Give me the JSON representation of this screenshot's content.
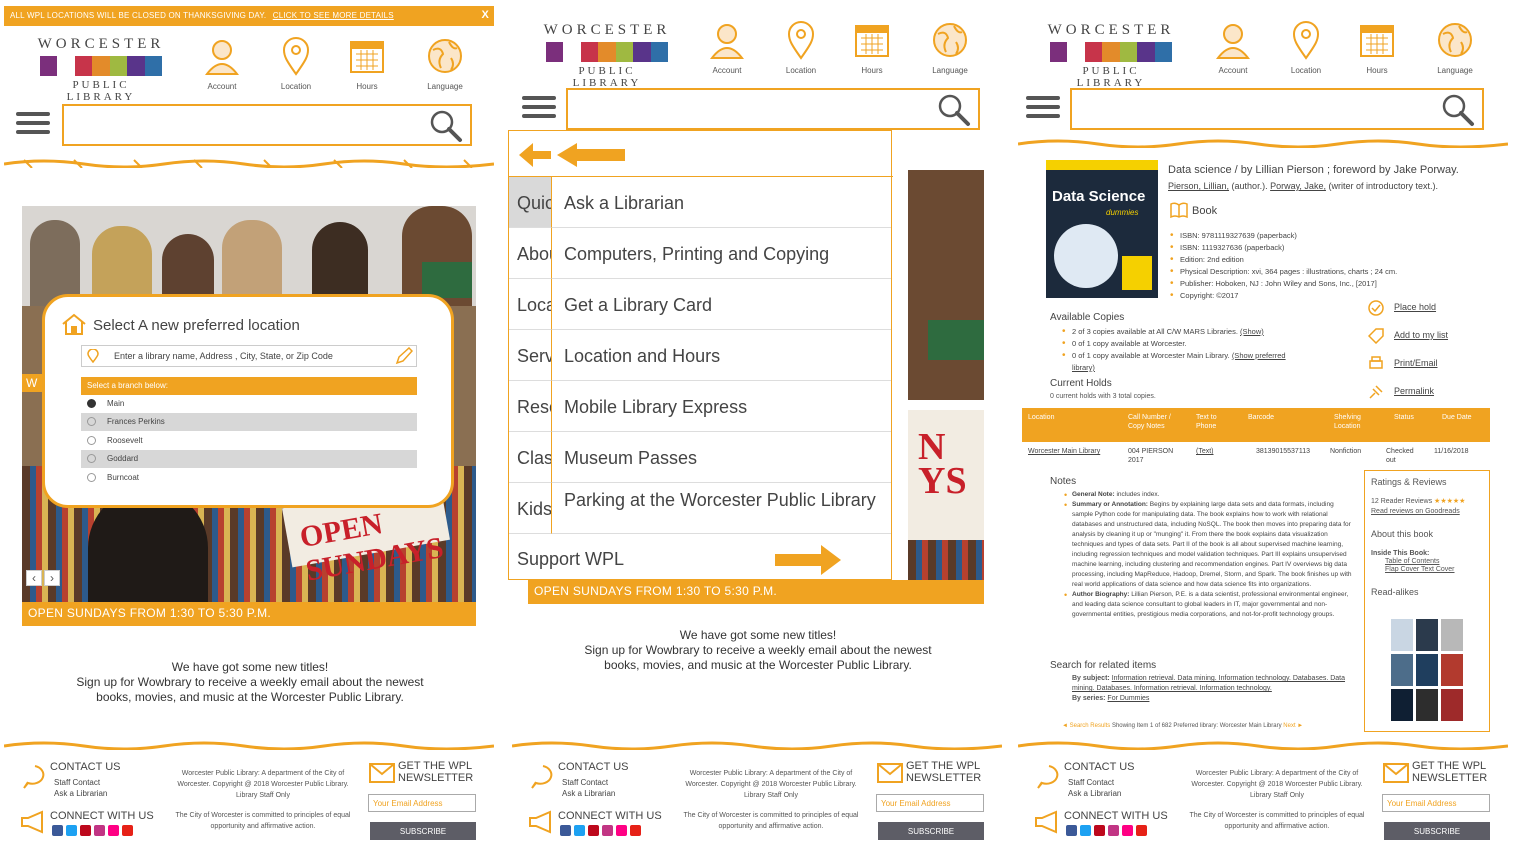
{
  "header": {
    "logo_top": "WORCESTER",
    "logo_bottom": "PUBLIC LIBRARY",
    "nav": [
      "Account",
      "Location",
      "Hours",
      "Language"
    ]
  },
  "alert": {
    "text": "ALL WPL LOCATIONS WILL BE CLOSED ON THANKSGIVING DAY.",
    "link": "CLICK TO SEE MORE DETAILS",
    "close": "X"
  },
  "hero": {
    "banner": "OPEN SUNDAYS FROM 1:30 TO 5:30 P.M.",
    "sign_text": "OPEN SUNDAYS",
    "w_letter": "W",
    "carousel_prev": "‹",
    "carousel_next": "›"
  },
  "promo": {
    "line1": "We have got some new titles!",
    "line2": "Sign up for Wowbrary to receive a weekly email about the newest",
    "line3": "books, movies, and music at the Worcester Public Library."
  },
  "location_modal": {
    "title": "Select A new preferred location",
    "placeholder": "Enter a library name, Address , City, State, or Zip Code",
    "select_header": "Select a branch below:",
    "options": [
      "Main",
      "Frances Perkins",
      "Roosevelt",
      "Goddard",
      "Burncoat"
    ],
    "selected": "Main"
  },
  "menu": {
    "left_tabs": [
      "Quick",
      "About",
      "Locations",
      "Services",
      "Resources",
      "Classes",
      "Kids"
    ],
    "items": [
      "Ask a Librarian",
      "Computers, Printing and Copying",
      "Get a Library Card",
      "Location and Hours",
      "Mobile Library Express",
      "Museum Passes",
      "Parking at the Worcester Public Library"
    ],
    "support": "Support WPL",
    "sign_text": "N\nYS"
  },
  "record": {
    "cover_title": "Data Science",
    "cover_sub": "dummies",
    "title": "Data science / by Lillian Pierson ; foreword by Jake Porway.",
    "author1": "Pierson, Lillian,",
    "author1_role": "(author.).",
    "author2": "Porway, Jake,",
    "author2_role": "(writer of introductory text.).",
    "type": "Book",
    "details": [
      "ISBN: 9781119327639 (paperback)",
      "ISBN: 1119327636 (paperback)",
      "Edition: 2nd edition",
      "Physical Description: xvi, 364 pages : illustrations, charts ; 24 cm.",
      "Publisher: Hoboken, NJ : John Wiley and Sons, Inc., [2017]",
      "Copyright: ©2017"
    ],
    "available_h": "Available Copies",
    "available": [
      "2 of 3 copies available at All C/W MARS Libraries.",
      "0 of 1 copy available at Worcester.",
      "0 of 1 copy available at Worcester Main Library."
    ],
    "show_link": "(Show)",
    "show_pref_link": "(Show preferred library)",
    "holds_h": "Current Holds",
    "holds": "0 current holds with 3 total copies.",
    "actions": [
      "Place hold",
      "Add to my list",
      "Print/Email",
      "Permalink"
    ],
    "table_headers": [
      "Location",
      "Call Number / Copy Notes",
      "Text to Phone",
      "Barcode",
      "Shelving Location",
      "Status",
      "Due Date"
    ],
    "table_row": [
      "Worcester Main Library",
      "004 PIERSON 2017",
      "(Text)",
      "38139015537113",
      "Nonfiction",
      "Checked out",
      "11/16/2018"
    ],
    "notes_h": "Notes",
    "notes": [
      {
        "label": "General Note:",
        "text": "includes index."
      },
      {
        "label": "Summary or Annotation:",
        "text": "Begins by explaining large data sets and data formats, including sample Python code for manipulating data. The book explains how to work with relational databases and unstructured data, including NoSQL. The book then moves into preparing data for analysis by cleaning it up or \"munging\" it. From there the book explains data visualization techniques and types of data sets. Part II of the book is all about supervised machine learning, including regression techniques and model validation techniques. Part III explains unsupervised machine learning, including clustering and recommendation engines. Part IV overviews big data processing, including MapReduce, Hadoop, Dremel, Storm, and Spark. The book finishes up with real world applications of data science and how data science fits into organizations."
      },
      {
        "label": "Author Biography:",
        "text": "Lillian Pierson, P.E. is a data scientist, professional environmental engineer, and leading data science consultant to global leaders in IT, major governmental and non-governmental entities, prestigious media corporations, and not-for-profit technology groups."
      }
    ],
    "related_h": "Search for related items",
    "by_subject": "By subject:",
    "subjects": "Information retrieval. Data mining. Information technology. Databases. Data mining. Databases. Information retrieval. Information technology.",
    "by_series": "By series:",
    "series": "For Dummies",
    "pager_prev": "◄ Search Results",
    "pager_text": "Showing Item 1 of 682 Preferred library: Worcester Main Library",
    "pager_next": "Next ►",
    "side_ratings_h": "Ratings & Reviews",
    "side_reviews": "12 Reader Reviews",
    "side_stars": "★★★★★",
    "side_goodreads": "Read reviews on Goodreads",
    "side_about_h": "About this book",
    "side_inside": "Inside This Book:",
    "side_links": [
      "Table of Contents",
      "Flap Cover Text Cover"
    ],
    "side_readalikes_h": "Read-alikes"
  },
  "footer": {
    "contact_h": "CONTACT US",
    "contact_links": [
      "Staff Contact",
      "Ask a Librarian"
    ],
    "connect_h": "CONNECT WITH US",
    "about": "Worcester Public Library: A department of the City of Worcester. Copyright @ 2018 Worcester Public Library. Library Staff Only",
    "equal": "The City of Worcester is committed to principles of equal opportunity and affirmative action.",
    "newsletter_h1": "GET THE WPL",
    "newsletter_h2": "NEWSLETTER",
    "email_placeholder": "Your Email Address",
    "subscribe": "SUBSCRIBE"
  },
  "colors": {
    "accent": "#f0a321",
    "subscribe": "#5d5d66",
    "text": "#444444"
  }
}
